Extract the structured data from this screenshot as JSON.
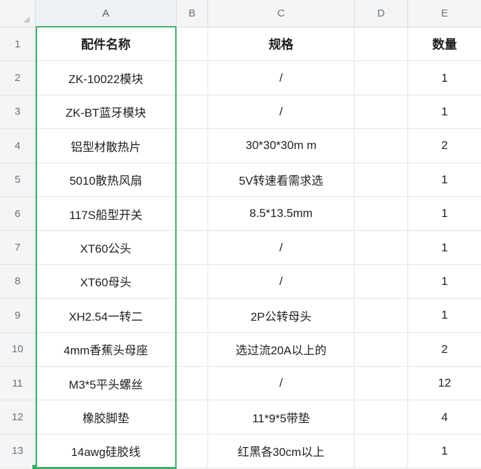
{
  "columns": [
    "A",
    "B",
    "C",
    "D",
    "E"
  ],
  "rows": [
    {
      "num": "1",
      "a": "配件名称",
      "c": "规格",
      "e": "数量"
    },
    {
      "num": "2",
      "a": "ZK-10022模块",
      "c": "/",
      "e": "1"
    },
    {
      "num": "3",
      "a": "ZK-BT蓝牙模块",
      "c": "/",
      "e": "1"
    },
    {
      "num": "4",
      "a": "铝型材散热片",
      "c": "30*30*30m m",
      "e": "2"
    },
    {
      "num": "5",
      "a": "5010散热风扇",
      "c": "5V转速看需求选",
      "e": "1"
    },
    {
      "num": "6",
      "a": "117S船型开关",
      "c": "8.5*13.5mm",
      "e": "1"
    },
    {
      "num": "7",
      "a": "XT60公头",
      "c": "/",
      "e": "1"
    },
    {
      "num": "8",
      "a": "XT60母头",
      "c": "/",
      "e": "1"
    },
    {
      "num": "9",
      "a": "XH2.54一转二",
      "c": "2P公转母头",
      "e": "1"
    },
    {
      "num": "10",
      "a": "4mm香蕉头母座",
      "c": "选过流20A以上的",
      "e": "2"
    },
    {
      "num": "11",
      "a": "M3*5平头螺丝",
      "c": "/",
      "e": "12"
    },
    {
      "num": "12",
      "a": "橡胶脚垫",
      "c": "11*9*5带垫",
      "e": "4"
    },
    {
      "num": "13",
      "a": "14awg硅胶线",
      "c": "红黑各30cm以上",
      "e": "1"
    }
  ],
  "colors": {
    "selection": "#3fae6a",
    "header_bg": "#f4f5f6",
    "grid": "#e4e4e4"
  }
}
